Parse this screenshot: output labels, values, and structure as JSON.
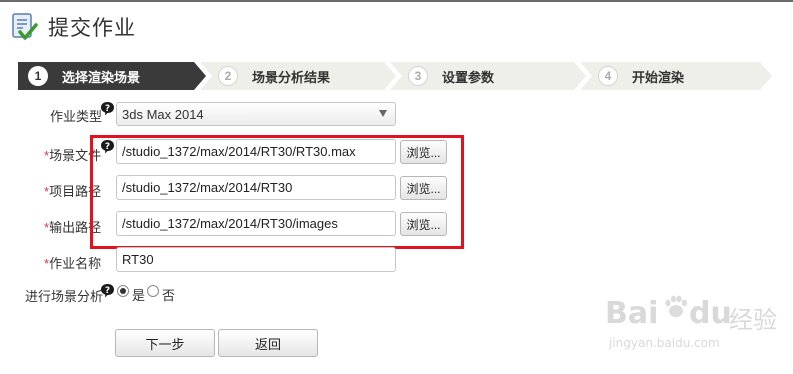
{
  "header": {
    "title": "提交作业"
  },
  "steps": [
    {
      "num": "1",
      "label": "选择渲染场景",
      "active": true
    },
    {
      "num": "2",
      "label": "场景分析结果",
      "active": false
    },
    {
      "num": "3",
      "label": "设置参数",
      "active": false
    },
    {
      "num": "4",
      "label": "开始渲染",
      "active": false
    }
  ],
  "form": {
    "job_type": {
      "label": "作业类型",
      "value": "3ds Max 2014"
    },
    "scene_file": {
      "required_mark": "*",
      "label": "场景文件",
      "value": "/studio_1372/max/2014/RT30/RT30.max",
      "browse": "浏览..."
    },
    "project_path": {
      "required_mark": "*",
      "label": "项目路径",
      "value": "/studio_1372/max/2014/RT30",
      "browse": "浏览..."
    },
    "output_path": {
      "required_mark": "*",
      "label": "输出路径",
      "value": "/studio_1372/max/2014/RT30/images",
      "browse": "浏览..."
    },
    "job_name": {
      "required_mark": "*",
      "label": "作业名称",
      "value": "RT30"
    },
    "scene_analysis": {
      "label": "进行场景分析",
      "yes": "是",
      "no": "否",
      "selected": "yes"
    }
  },
  "actions": {
    "next": "下一步",
    "back": "返回"
  },
  "watermark": {
    "brand": "Bai",
    "brand2": "du",
    "suffix": "经验",
    "site": "jingyan.baidu.com"
  },
  "colors": {
    "active_step": "#3a3a3a",
    "inactive_step": "#efefe9",
    "required": "#d9363e",
    "highlight": "#e0141e"
  }
}
